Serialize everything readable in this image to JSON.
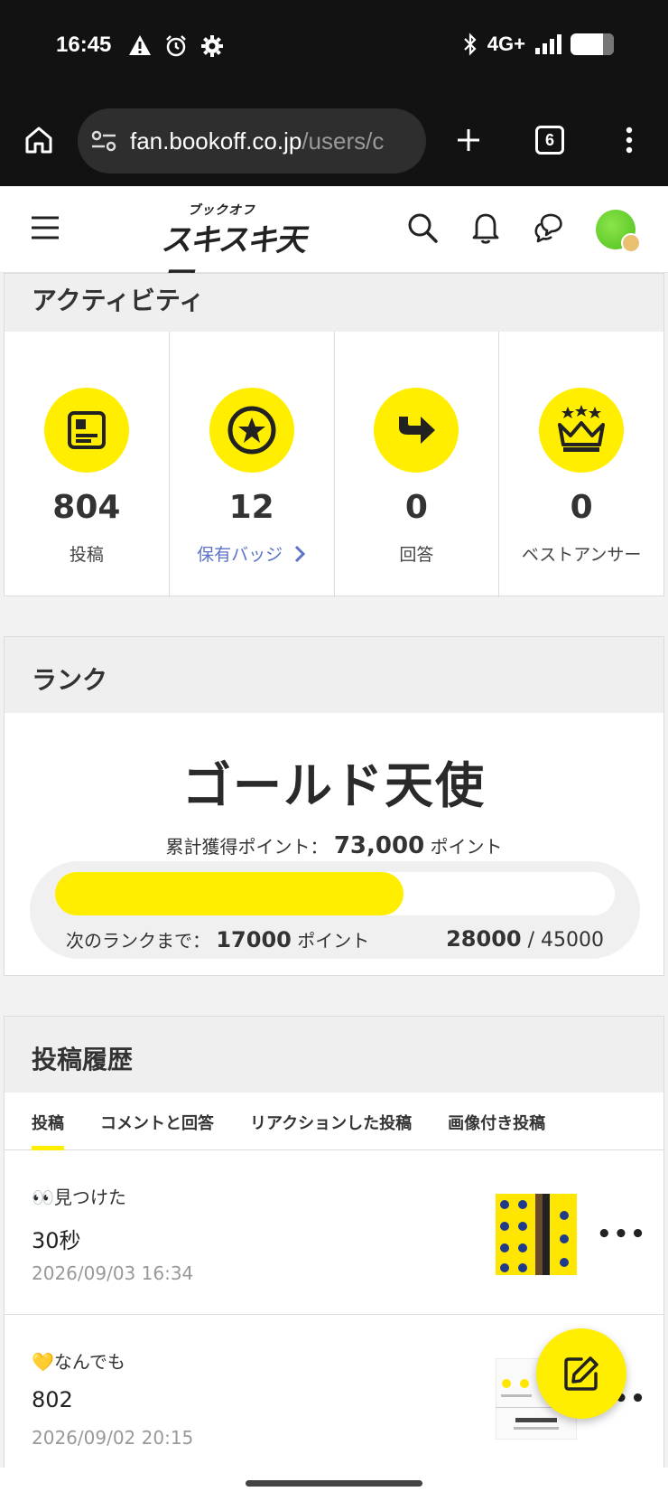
{
  "status_bar": {
    "time": "16:45",
    "network": "4G+",
    "icons_left": [
      "warning-icon",
      "alarm-icon",
      "settings-icon"
    ],
    "icons_right": [
      "bluetooth-icon",
      "signal-icon",
      "battery-icon"
    ]
  },
  "browser": {
    "url_host": "fan.bookoff.co.jp",
    "url_path": "/users/c",
    "tab_count": "6"
  },
  "site_header": {
    "logo_small": "ブックオフ",
    "logo_big": "スキスキ天国"
  },
  "activity": {
    "title": "アクティビティ",
    "stats": [
      {
        "value": "804",
        "label": "投稿",
        "icon": "post-icon"
      },
      {
        "value": "12",
        "label": "保有バッジ",
        "icon": "badge-star-icon"
      },
      {
        "value": "0",
        "label": "回答",
        "icon": "answer-arrow-icon"
      },
      {
        "value": "0",
        "label": "ベストアンサー",
        "icon": "crown-icon"
      }
    ]
  },
  "rank": {
    "title": "ランク",
    "rank_name": "ゴールド天使",
    "total_label": "累計獲得ポイント：",
    "total_points": "73,000",
    "unit": "ポイント",
    "next_label": "次のランクまで：",
    "next_points": "17000",
    "current": "28000",
    "separator": " / ",
    "target": "45000",
    "progress_fraction": 0.622
  },
  "history": {
    "title": "投稿履歴",
    "tabs": [
      "投稿",
      "コメントと回答",
      "リアクションした投稿",
      "画像付き投稿"
    ],
    "posts": [
      {
        "category": "👀見つけた",
        "title": "30秒",
        "date": "2026/09/03 16:34"
      },
      {
        "category": "💛なんでも",
        "title": "802",
        "date": "2026/09/02 20:15"
      }
    ],
    "more": "•••"
  },
  "colors": {
    "accent": "#ffee00",
    "link": "#5a72c8",
    "chrome": "#121212"
  }
}
